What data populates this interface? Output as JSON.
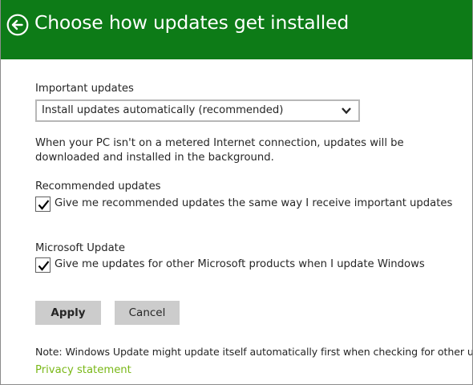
{
  "colors": {
    "header_bg": "#0d7b17",
    "header_text": "#ffffff",
    "link": "#7ab818",
    "button_bg": "#cccccc"
  },
  "header": {
    "back_icon": "back-arrow-circle-icon",
    "title": "Choose how updates get installed"
  },
  "important_updates": {
    "label": "Important updates",
    "selected": "Install updates automatically (recommended)",
    "chevron_icon": "chevron-down-icon",
    "description": "When your PC isn't on a metered Internet connection, updates will be downloaded and installed in the background."
  },
  "recommended_updates": {
    "label": "Recommended updates",
    "checkbox_label": "Give me recommended updates the same way I receive important updates",
    "checked": true
  },
  "microsoft_update": {
    "label": "Microsoft Update",
    "checkbox_label": "Give me updates for other Microsoft products when I update Windows",
    "checked": true
  },
  "buttons": {
    "apply": "Apply",
    "cancel": "Cancel"
  },
  "footer": {
    "note": "Note: Windows Update might update itself automatically first when checking for other updates.",
    "privacy_link": "Privacy statement"
  }
}
